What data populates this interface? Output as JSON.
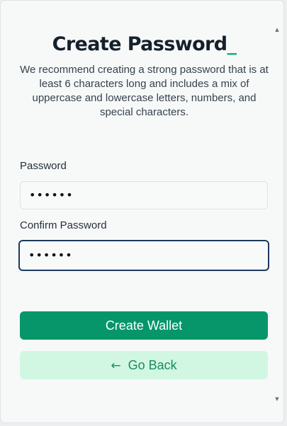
{
  "header": {
    "title": "Create Password",
    "cursor": "_",
    "description": "We recommend creating a strong password that is at least 6 characters long and includes a mix of uppercase and lowercase letters, numbers, and special characters."
  },
  "form": {
    "password_label": "Password",
    "password_value": "••••••",
    "confirm_label": "Confirm Password",
    "confirm_value": "••••••"
  },
  "actions": {
    "create_label": "Create Wallet",
    "back_label": "Go Back",
    "back_icon": "arrow-left-icon"
  },
  "colors": {
    "primary": "#069669",
    "secondary_bg": "#d1f7e3",
    "secondary_text": "#1a8c5f",
    "focus_border": "#1b3a5c",
    "cursor": "#13b07a"
  }
}
